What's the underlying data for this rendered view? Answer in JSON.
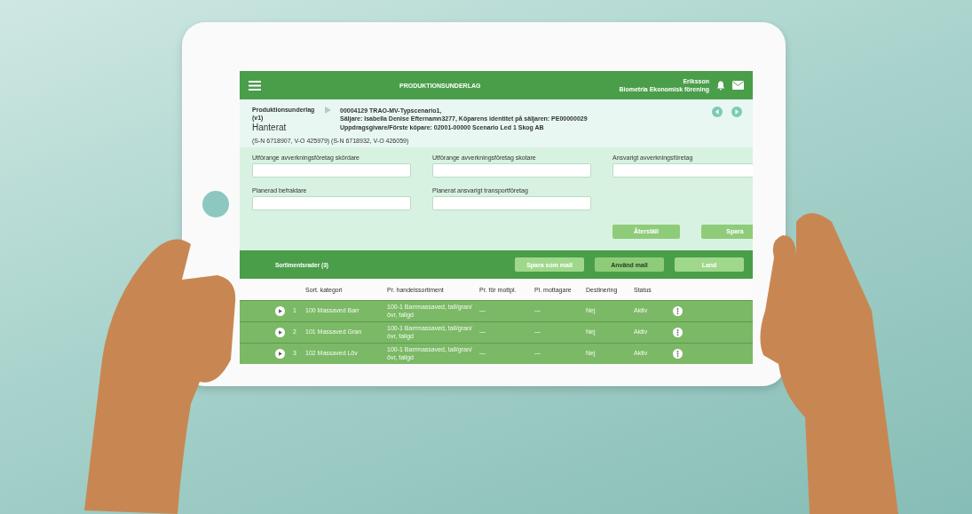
{
  "header": {
    "title": "PRODUKTIONSUNDERLAG",
    "user_name": "Eriksson",
    "organization": "Biometria Ekonomisk förening"
  },
  "info": {
    "document_label": "Produktionsunderlag",
    "version": "(v1)",
    "status": "Hanterat",
    "details": [
      "00004129 TRAO-MV-Typscenario1,",
      "Säljare: Isabella Denise Efternamn3277, Köparens identitet på säljaren: PE00000029",
      "Uppdragsgivare/Förste köpare: 02001-00000 Scenario Led 1 Skog AB"
    ],
    "coordinates": "(S-N 6718907, V-O 425979) (S-N 6718932, V-O 426059)"
  },
  "form": {
    "fields": [
      {
        "label": "Utförange avverkningsföretag skördare"
      },
      {
        "label": "Utförange avverkningsföretag skotare"
      },
      {
        "label": "Ansvarigt avverkningsföretag"
      },
      {
        "label": "Planerad befraktare"
      },
      {
        "label": "Planerat ansvarigt transportföretag"
      }
    ],
    "buttons": [
      "Återställ",
      "Spara"
    ]
  },
  "table": {
    "title": "Sortimentsrader (3)",
    "buttons": [
      "Spara som mall",
      "Använd mall",
      "Land"
    ],
    "columns": [
      "Sort. kategori",
      "Pr. handelssortiment",
      "Pr. för mottpl.",
      "Pl. mottagare",
      "Destinering",
      "Status"
    ],
    "rows": [
      {
        "number": "1",
        "category": "100 Massaved Barr",
        "assortment": "100-1 Barrmassaved, tall/gran/övr, fallgd",
        "receiving_point": "—",
        "receiver": "—",
        "destination": "Nej",
        "status": "Aktiv"
      },
      {
        "number": "2",
        "category": "101 Massaved Gran",
        "assortment": "100-1 Barrmassaved, tall/gran/övr, fallgd",
        "receiving_point": "—",
        "receiver": "—",
        "destination": "Nej",
        "status": "Aktiv"
      },
      {
        "number": "3",
        "category": "102 Massaved Löv",
        "assortment": "100-1 Barrmassaved, tall/gran/övr, fallgd",
        "receiving_point": "—",
        "receiver": "—",
        "destination": "Nej",
        "status": "Aktiv"
      }
    ]
  }
}
